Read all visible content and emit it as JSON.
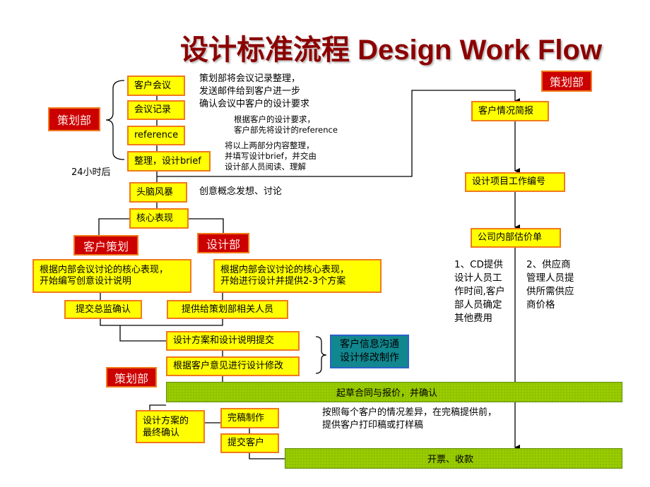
{
  "title": "设计标准流程 Design Work Flow",
  "departments": {
    "planning": "策划部",
    "client_planning": "客户策划",
    "design": "设计部"
  },
  "left_column": {
    "client_meeting": "客户会议",
    "meeting_minutes": "会议记录",
    "reference": "reference",
    "brief": "整理，设计brief",
    "after_24h": "24小时后",
    "brainstorm": "头脑风暴",
    "core_expression": "核心表现"
  },
  "notes": {
    "meeting_note": "策划部将会议记录整理，\n发送邮件给到客户进一步\n确认会议中客户的设计要求",
    "reference_note": "根据客户的设计要求，\n客户部先将设计的reference",
    "brief_note": "将以上两部分内容整理，\n并填写设计brief，并交由\n设计部人员阅读、理解",
    "brainstorm_note": "创意概念发想、讨论",
    "cd_note": "1、CD提供\n设计人员工\n作时间,客户\n部人员确定\n其他费用",
    "supplier_note": "2、供应商\n管理人员提\n供所需供应\n商价格",
    "proof_note": "按照每个客户的情况差异，在完稿提供前，\n提供客户打印稿或打样稿"
  },
  "branches": {
    "client_planning_task": "根据内部会议讨论的核心表现，\n开始编写创意设计说明",
    "design_task": "根据内部会议讨论的核心表现，\n开始进行设计并提供2-3个方案",
    "submit_director": "提交总监确认",
    "provide_planning": "提供给策划部相关人员"
  },
  "review": {
    "submit_proposal": "设计方案和设计说明提交",
    "revise": "根据客户意见进行设计修改",
    "communication": "客户信息沟通\n设计修改制作"
  },
  "right_column": {
    "client_brief": "客户情况简报",
    "project_number": "设计项目工作编号",
    "internal_quote": "公司内部估价单"
  },
  "final": {
    "contract": "起草合同与报价，并确认",
    "final_confirm": "设计方案的\n最终确认",
    "artwork": "完稿制作",
    "submit_client": "提交客户",
    "invoice": "开票、收款"
  }
}
